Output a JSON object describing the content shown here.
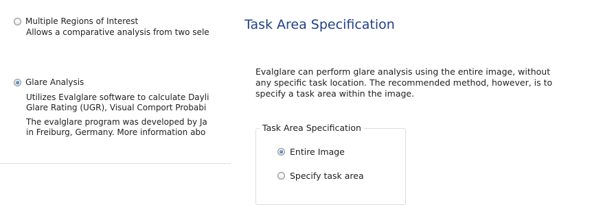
{
  "left_panel": {
    "options": [
      {
        "title": "Multiple Regions of Interest",
        "selected": false,
        "desc": [
          "Allows a comparative analysis from two sele"
        ]
      },
      {
        "title": "Glare Analysis",
        "selected": true,
        "desc_p1": [
          "Utilizes Evalglare software to calculate Dayli",
          "Glare Rating (UGR), Visual Comport Probabi"
        ],
        "desc_p2": [
          "The evalglare program was developed by Ja",
          "in Freiburg, Germany. More information abo"
        ]
      }
    ]
  },
  "right_panel": {
    "heading": "Task Area Specification",
    "intro_lines": [
      "Evalglare can perform glare analysis using the entire image, without",
      "any specific task location. The recommended method, however, is to",
      "specify a task area within the image."
    ],
    "groupbox": {
      "legend": "Task Area Specification",
      "options": [
        {
          "label": "Entire Image",
          "selected": true
        },
        {
          "label": "Specify task area",
          "selected": false
        }
      ]
    }
  },
  "colors": {
    "heading": "#1f3f88",
    "radio_dot": "#1f5fa8",
    "groupbox_border": "#d5dfe5"
  }
}
